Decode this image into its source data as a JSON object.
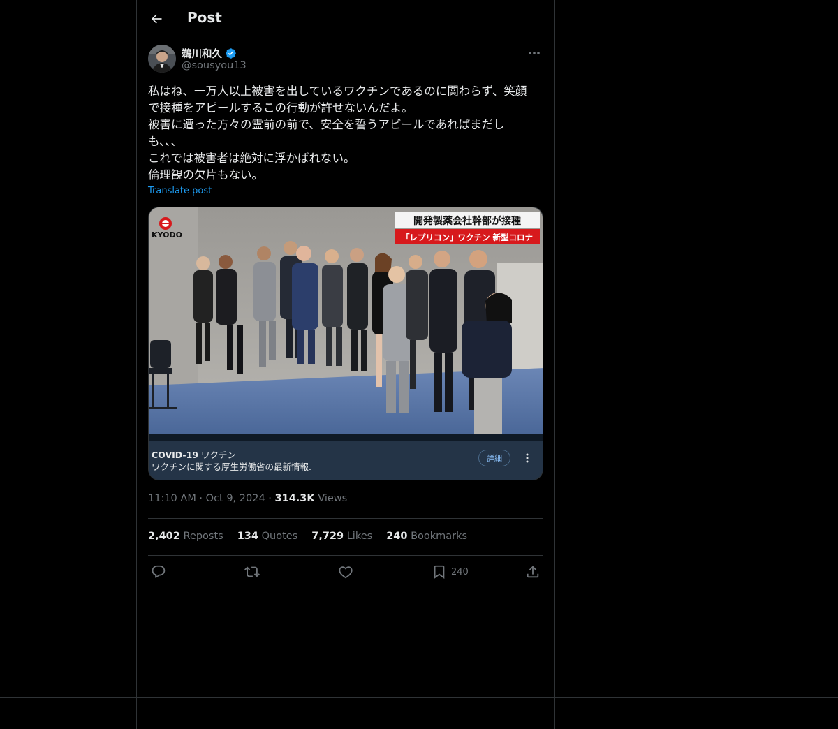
{
  "header": {
    "title": "Post"
  },
  "author": {
    "display_name": "鵜川和久",
    "handle": "@sousyou13",
    "verified": true
  },
  "post": {
    "text": "私はね、一万人以上被害を出しているワクチンであるのに関わらず、笑顔\nで接種をアピールするこの行動が許せないんだよ。\n被害に遭った方々の霊前の前で、安全を誓うアピールであればまだし\nも、、、\nこれでは被害者は絶対に浮かばれない。\n倫理観の欠片もない。",
    "translate_label": "Translate post"
  },
  "media": {
    "logo_text": "KYODO",
    "headline": "開発製薬会社幹部が接種",
    "subheadline": "「レプリコン」ワクチン 新型コロナ",
    "ad_title_bold": "COVID-19",
    "ad_title_rest": " ワクチン",
    "ad_subtitle": "ワクチンに関する厚生労働省の最新情報.",
    "ad_button": "詳細"
  },
  "meta": {
    "time": "11:10 AM",
    "sep1": " · ",
    "date": "Oct 9, 2024",
    "sep2": " · ",
    "views_count": "314.3K",
    "views_label": " Views"
  },
  "stats": {
    "reposts_count": "2,402",
    "reposts_label": " Reposts",
    "quotes_count": "134",
    "quotes_label": " Quotes",
    "likes_count": "7,729",
    "likes_label": " Likes",
    "bookmarks_count": "240",
    "bookmarks_label": " Bookmarks"
  },
  "actions": {
    "bookmark_count": "240"
  },
  "colors": {
    "background": "#000000",
    "accent": "#1d9bf0",
    "border": "#2f3336",
    "muted": "#71767b",
    "text": "#e7e9ea",
    "banner_red": "#d7191c"
  },
  "icons": [
    "arrow-left-icon",
    "verified-badge-icon",
    "more-horizontal-icon",
    "more-vertical-icon",
    "reply-icon",
    "repost-icon",
    "like-icon",
    "bookmark-icon",
    "share-icon"
  ]
}
